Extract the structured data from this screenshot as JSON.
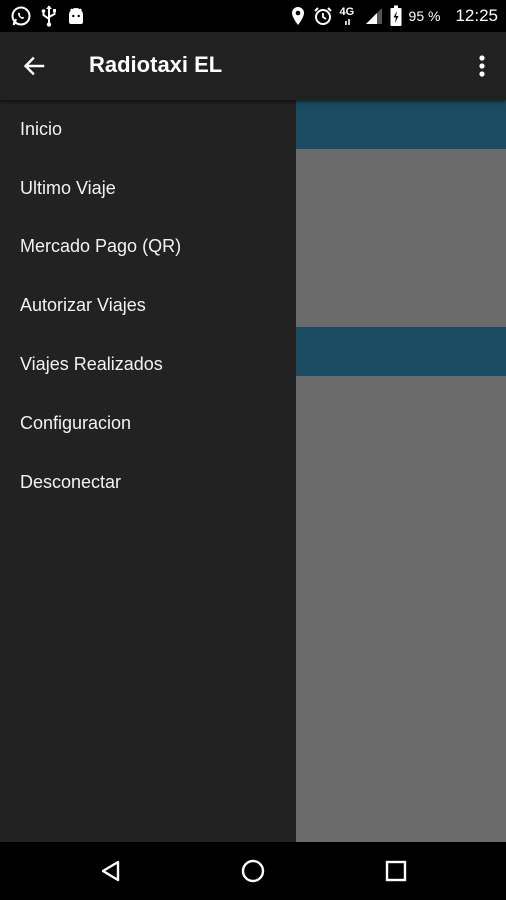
{
  "status_bar": {
    "battery_label": "95 %",
    "time": "12:25",
    "network": "4G",
    "left_icons": [
      "whatsapp-icon",
      "usb-icon",
      "android-icon"
    ],
    "right_icons": [
      "location-icon",
      "alarm-icon",
      "signal-icon",
      "battery-icon"
    ]
  },
  "app_bar": {
    "title": "Radiotaxi EL",
    "back_icon": "arrow-back-icon",
    "overflow_icon": "more-vert-icon"
  },
  "drawer": {
    "items": [
      {
        "label": "Inicio"
      },
      {
        "label": "Ultimo Viaje"
      },
      {
        "label": "Mercado Pago (QR)"
      },
      {
        "label": "Autorizar Viajes"
      },
      {
        "label": "Viajes Realizados"
      },
      {
        "label": "Configuracion"
      },
      {
        "label": "Desconectar"
      }
    ]
  },
  "nav_bar": {
    "buttons": [
      "back-triangle-icon",
      "home-circle-icon",
      "recents-square-icon"
    ]
  },
  "colors": {
    "app_bar": "#212121",
    "drawer": "#222222",
    "content_bg": "#6b6b6b",
    "accent_stripe": "#1a4b61"
  }
}
